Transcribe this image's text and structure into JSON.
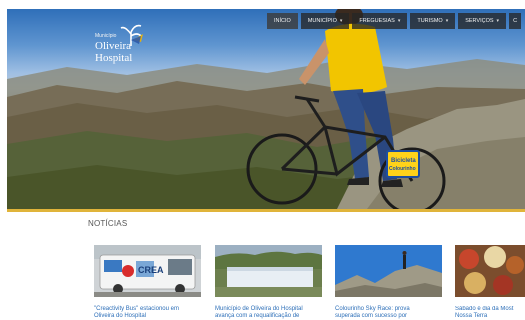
{
  "header": {
    "logo": {
      "small": "Município",
      "name_line1": "Oliveira",
      "name_line2": "Hospital"
    },
    "nav": [
      {
        "label": "INÍCIO",
        "has_dropdown": false
      },
      {
        "label": "MUNICÍPIO",
        "has_dropdown": true
      },
      {
        "label": "FREGUESIAS",
        "has_dropdown": true
      },
      {
        "label": "TURISMO",
        "has_dropdown": true
      },
      {
        "label": "SERVIÇOS",
        "has_dropdown": true
      },
      {
        "label": "C",
        "has_dropdown": false
      }
    ]
  },
  "hero": {
    "sign_text_line1": "Bicicleta",
    "sign_text_line2": "Colourinho"
  },
  "news": {
    "title": "NOTÍCIAS",
    "items": [
      {
        "text_line1": "\"Creactivity Bus\" estacionou em",
        "text_line2": "Oliveira do Hospital",
        "bus_text": "CREA"
      },
      {
        "text_line1": "Município de Oliveira do Hospital",
        "text_line2": "avança com a requalificação de"
      },
      {
        "text_line1": "Colourinho Sky Race: prova",
        "text_line2": "superada com sucesso por"
      },
      {
        "text_line1": "Sábado é dia da Most",
        "text_line2": "Nossa Terra"
      }
    ]
  },
  "colors": {
    "accent": "#e0b43a",
    "link": "#2d6fb8",
    "nav_bg": "#262626"
  }
}
